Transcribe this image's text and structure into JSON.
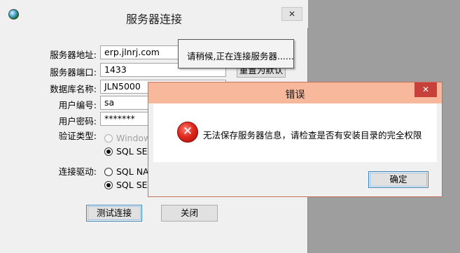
{
  "main_window": {
    "title": "服务器连接",
    "close_glyph": "✕",
    "fields": [
      {
        "label": "服务器地址:",
        "value": "erp.jlnrj.com"
      },
      {
        "label": "服务器端口:",
        "value": "1433"
      },
      {
        "label": "数据库名称:",
        "value": "JLN5000"
      },
      {
        "label": "用户编号:",
        "value": "sa"
      },
      {
        "label": "用户密码:",
        "value": "*******"
      }
    ],
    "default_button_label": "重置为默认",
    "auth_label": "验证类型:",
    "auth_options": [
      {
        "label": "Windows",
        "selected": false,
        "disabled": true
      },
      {
        "label": "SQL SER",
        "selected": true,
        "disabled": false
      }
    ],
    "driver_label": "连接驱动:",
    "driver_options": [
      {
        "label": "SQL NAT",
        "selected": false
      },
      {
        "label": "SQL SER",
        "selected": true
      }
    ],
    "test_button": "测试连接",
    "close_button": "关闭"
  },
  "status_popup": {
    "text": "请稍候,正在连接服务器......"
  },
  "error_dialog": {
    "title": "错误",
    "close_glyph": "✕",
    "icon": "error-icon",
    "icon_glyph": "✕",
    "message": "无法保存服务器信息，请检查是否有安装目录的完全权限",
    "ok_button": "确定"
  },
  "colors": {
    "dialog_title_bg": "#f7b89c",
    "dialog_close_bg": "#c7413a",
    "error_icon": "#e02a1f",
    "background": "#9e9e9e"
  }
}
